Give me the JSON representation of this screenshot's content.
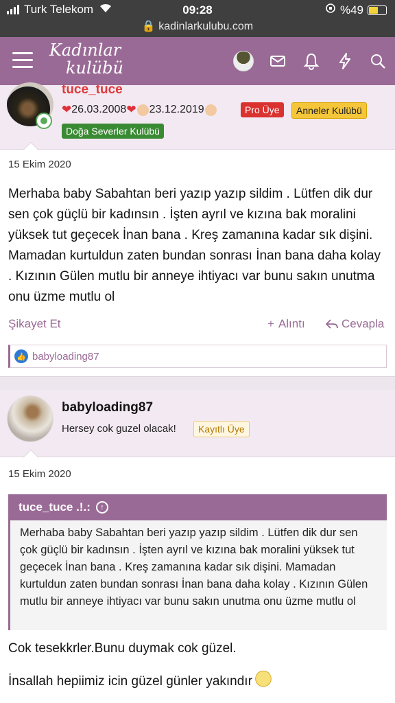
{
  "status_bar": {
    "carrier": "Turk Telekom",
    "time": "09:28",
    "battery": "%49",
    "url": "kadinlarkulubu.com"
  },
  "nav": {
    "logo_line1": "Kadınlar",
    "logo_line2": "kulübü",
    "icons": [
      "menu-icon",
      "avatar",
      "mail-icon",
      "bell-icon",
      "lightning-icon",
      "search-icon"
    ]
  },
  "post1": {
    "username": "tuce_tuce",
    "title_date1": "26.03.2008",
    "title_date2": "23.12.2019",
    "badges": [
      "Pro Üye",
      "Anneler Kulübü",
      "Doğa Severler Kulübü"
    ],
    "date": "15 Ekim 2020",
    "body": "Merhaba baby Sabahtan beri yazıp yazıp sildim . Lütfen dik dur sen çok güçlü bir kadınsın . İşten ayrıl ve kızına bak moralini yüksek tut geçecek İnan bana . Kreş zamanına kadar sık dişini. Mamadan kurtuldun zaten bundan sonrası İnan bana daha kolay . Kızının Gülen mutlu bir anneye ihtiyacı var bunu sakın unutma onu üzme mutlu ol",
    "actions": {
      "report": "Şikayet Et",
      "quote": "Alıntı",
      "reply": "Cevapla"
    },
    "liked_by": "babyloading87"
  },
  "post2": {
    "username": "babyloading87",
    "user_title": "Hersey cok guzel olacak!",
    "badge": "Kayıtlı Üye",
    "date": "15 Ekim 2020",
    "quote_author": "tuce_tuce .!.:",
    "quote_text": "Merhaba baby Sabahtan beri yazıp yazıp sildim . Lütfen dik dur sen çok güçlü bir kadınsın . İşten ayrıl ve kızına bak moralini yüksek tut geçecek İnan bana . Kreş zamanına kadar sık dişini. Mamadan kurtuldun zaten bundan sonrası İnan bana daha kolay . Kızının Gülen mutlu bir anneye ihtiyacı var bunu sakın unutma onu üzme mutlu ol",
    "reply_line1": "Cok tesekkrler.Bunu duymak cok güzel.",
    "reply_line2": "İnsallah hepiimiz icin güzel günler yakındır"
  },
  "colors": {
    "nav": "#9a6a96",
    "header_bg": "#f3e9f2",
    "pro_badge": "#d9322f",
    "anneler_badge": "#f5c63a",
    "doga_badge": "#3a8a34"
  }
}
